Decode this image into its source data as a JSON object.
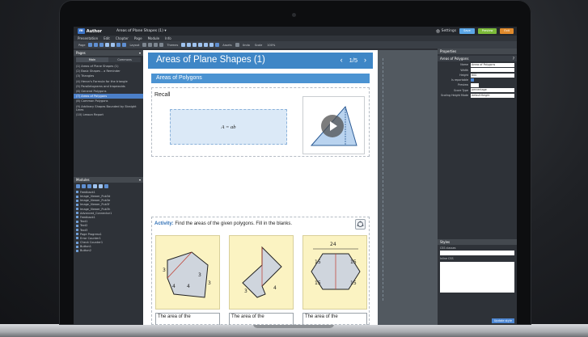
{
  "colors": {
    "accent": "#3e86c6",
    "save": "#5ba6e6",
    "preview": "#7cba3a",
    "exit": "#e08a2c"
  },
  "topbar": {
    "logo": "m",
    "app_name": "Author",
    "doc_title": "Areas of Plane Shapes (1)",
    "doc_caret": "▾",
    "settings_label": "Settings",
    "save_label": "Save",
    "preview_label": "Preview",
    "exit_label": "Exit"
  },
  "menu": [
    "Presentation",
    "Edit",
    "Chapter",
    "Page",
    "Module",
    "Info"
  ],
  "toolbar": {
    "page_label": "Page",
    "layout_label": "Layout",
    "themes_label": "Themes",
    "assets_label": "Assets",
    "undo_label": "Undo",
    "scale_label": "Scale",
    "zoom": "100%"
  },
  "pages_panel": {
    "title": "Pages",
    "tabs": [
      "Main",
      "Commons"
    ],
    "items": [
      "(1) Areas of Plane Shapes (1)",
      "(2) Basic Shapes – a Reminder",
      "(3) Triangles",
      "(4) Heron's Formula for the triangle",
      "(5) Parallelograms and trapezoids",
      "(6) General Polygons",
      "(7) Areas of Polygons",
      "(8) Common Polygons",
      "(9) Arbitrary Shapes Bounded by Straight Lines",
      "(10) Lesson Report"
    ],
    "selected_index": 6
  },
  "modules_panel": {
    "title": "Modules",
    "items": [
      "Feedback1",
      "Image_Viewer_Pub3d",
      "Image_Viewer_Pub3e",
      "Image_Viewer_Pub3f",
      "Image_Viewer_Pub3h",
      "Advanced_Connector1",
      "Feedback1",
      "Text1",
      "Text2",
      "Text3",
      "Page Progress1",
      "Error Counter1",
      "Check Counter1",
      "Button1",
      "Button2"
    ]
  },
  "slide": {
    "title": "Areas of Plane Shapes (1)",
    "prev": "‹",
    "next": "›",
    "page_indicator": "1/5",
    "section_title": "Areas of Polygons",
    "recall_label": "Recall",
    "formula": "A = ab",
    "activity_label": "Activity:",
    "activity_text": "Find the areas of the given polygons. Fill in the blanks.",
    "answer_prompts": [
      "The area of the",
      "The area of the",
      "The area of the"
    ],
    "fig1_labels": [
      "3",
      "4",
      "3",
      "4",
      "3"
    ],
    "fig2_labels": [
      "3",
      "4"
    ],
    "fig3_labels": [
      "24",
      "15",
      "15",
      "15",
      "15"
    ]
  },
  "properties_panel": {
    "title": "Properties",
    "section": "Areas of Polygons",
    "rows": [
      {
        "label": "Name",
        "value": "Areas of Polygons"
      },
      {
        "label": "Width",
        "value": ""
      },
      {
        "label": "Height",
        "value": "600"
      },
      {
        "label": "Is reportable",
        "value": ""
      },
      {
        "label": "Preview",
        "value": ""
      },
      {
        "label": "Score Type",
        "value": "percentage"
      },
      {
        "label": "Scaling Height Mode",
        "value": "defaultHeight"
      }
    ]
  },
  "styles_panel": {
    "title": "Styles",
    "css_classes_label": "CSS classes",
    "inline_css_label": "Inline CSS",
    "update_button": "Update style"
  }
}
